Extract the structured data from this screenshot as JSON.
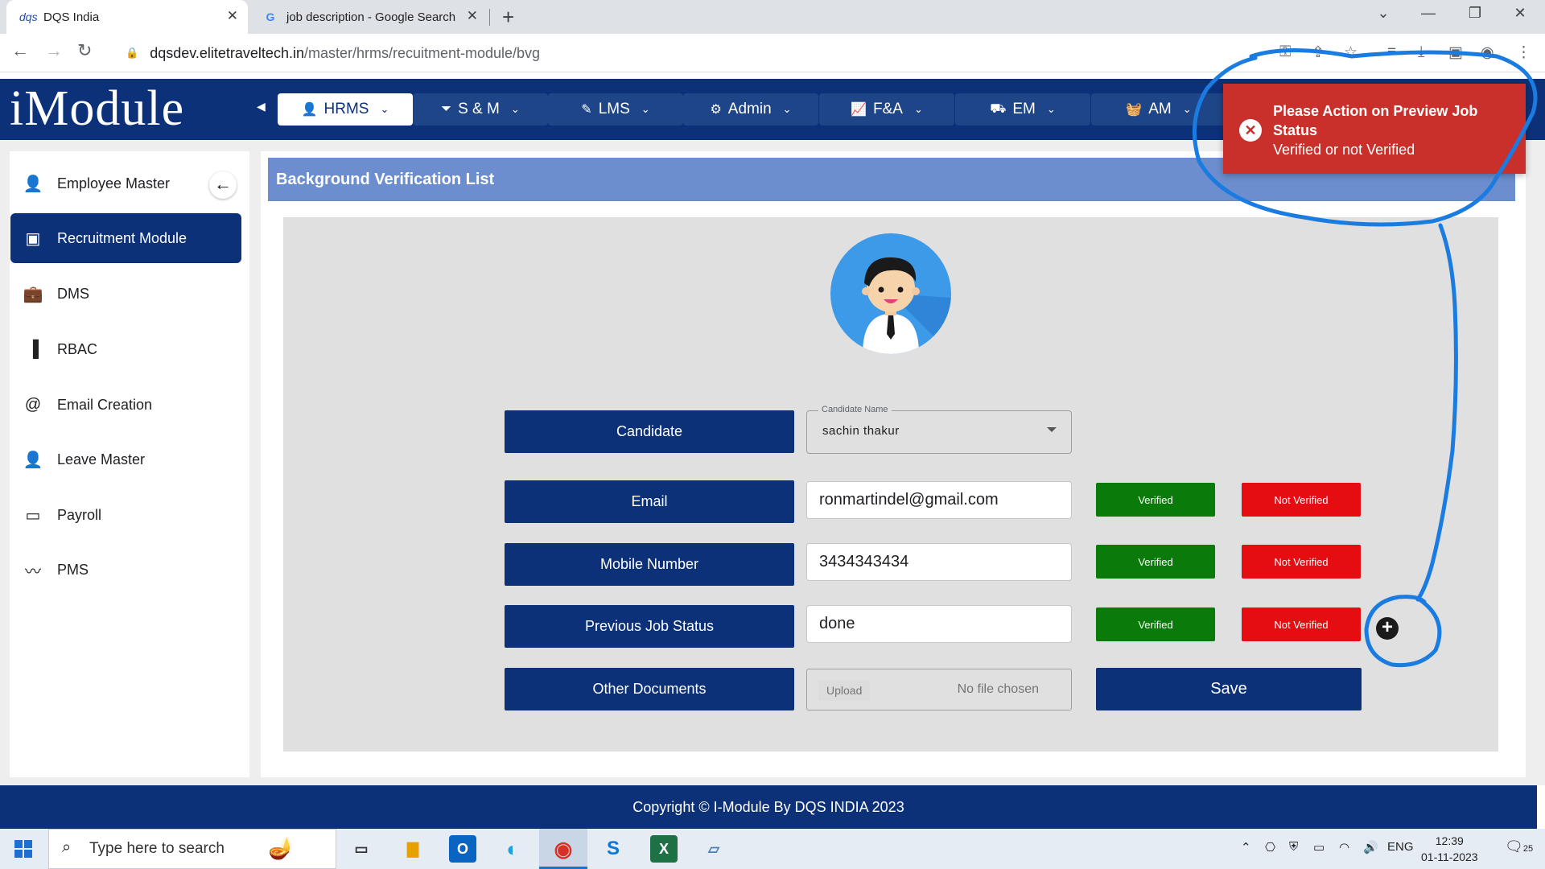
{
  "browser": {
    "tabs": [
      {
        "label": "DQS India",
        "favicon": "dqs"
      },
      {
        "label": "job description - Google Search",
        "favicon": "G"
      }
    ],
    "url_host": "dqsdev.elitetraveltech.in",
    "url_path": "/master/hrms/recuitment-module/bvg"
  },
  "app": {
    "logo": "iModule",
    "nav": [
      {
        "label": "HRMS",
        "icon": "person-tie-icon"
      },
      {
        "label": "S & M",
        "icon": "funnel-icon"
      },
      {
        "label": "LMS",
        "icon": "edit-icon"
      },
      {
        "label": "Admin",
        "icon": "user-gear-icon"
      },
      {
        "label": "F&A",
        "icon": "chart-line-icon"
      },
      {
        "label": "EM",
        "icon": "person-dolly-icon"
      },
      {
        "label": "AM",
        "icon": "basket-icon"
      }
    ]
  },
  "sidebar": {
    "items": [
      {
        "label": "Employee Master",
        "icon": "person-icon"
      },
      {
        "label": "Recruitment Module",
        "icon": "folder-plus-icon"
      },
      {
        "label": "DMS",
        "icon": "briefcase-icon"
      },
      {
        "label": "RBAC",
        "icon": "door-icon"
      },
      {
        "label": "Email Creation",
        "icon": "at-icon"
      },
      {
        "label": "Leave Master",
        "icon": "person-icon"
      },
      {
        "label": "Payroll",
        "icon": "card-icon"
      },
      {
        "label": "PMS",
        "icon": "trend-icon"
      }
    ]
  },
  "page": {
    "title": "Background Verification List",
    "candidate": {
      "label": "Candidate",
      "field_legend": "Candidate Name",
      "value": "sachin thakur"
    },
    "rows": [
      {
        "label": "Email",
        "value": "ronmartindel@gmail.com"
      },
      {
        "label": "Mobile Number",
        "value": "3434343434"
      },
      {
        "label": "Previous Job Status",
        "value": "done"
      }
    ],
    "verified_label": "Verified",
    "not_verified_label": "Not Verified",
    "other_docs_label": "Other Documents",
    "upload_label": "Upload",
    "no_file_label": "No file chosen",
    "save_label": "Save"
  },
  "toast": {
    "title": "Please Action on Preview Job Status",
    "message": "Verified or not Verified",
    "color": "#c9302c"
  },
  "footer": {
    "text": "Copyright © I-Module By DQS INDIA 2023"
  },
  "taskbar": {
    "search_placeholder": "Type here to search",
    "language": "ENG",
    "time": "12:39",
    "date": "01-11-2023",
    "notification_count": "25"
  },
  "colors": {
    "brand": "#0c3178",
    "header_bar": "#6c8ecf",
    "verified": "#0a7a0a",
    "not_verified": "#e50c12",
    "annotation": "#1a7be0"
  }
}
